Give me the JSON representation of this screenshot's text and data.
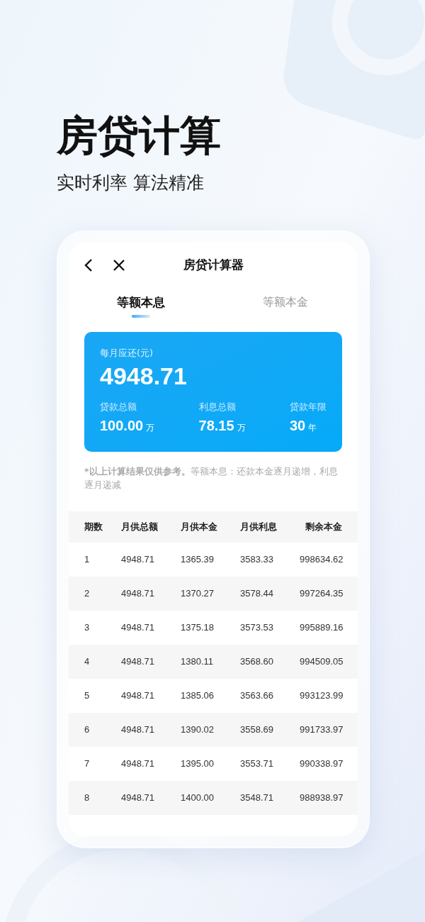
{
  "headline": "房贷计算",
  "subtitle": "实时利率 算法精准",
  "screen": {
    "title": "房贷计算器",
    "tabs": [
      {
        "label": "等额本息",
        "selected": true
      },
      {
        "label": "等额本金",
        "selected": false
      }
    ],
    "summary": {
      "monthly_label": "每月应还(元)",
      "monthly_value": "4948.71",
      "stats": [
        {
          "label": "贷款总额",
          "value": "100.00",
          "unit": "万"
        },
        {
          "label": "利息总额",
          "value": "78.15",
          "unit": "万"
        },
        {
          "label": "贷款年限",
          "value": "30",
          "unit": "年"
        }
      ]
    },
    "note": "***以上计算结果仅供参考。**等额本息：还款本金逐月递增，利息逐月递减",
    "table": {
      "columns": [
        "期数",
        "月供总额",
        "月供本金",
        "月供利息",
        "剩余本金"
      ],
      "rows": [
        [
          "1",
          "4948.71",
          "1365.39",
          "3583.33",
          "998634.62"
        ],
        [
          "2",
          "4948.71",
          "1370.27",
          "3578.44",
          "997264.35"
        ],
        [
          "3",
          "4948.71",
          "1375.18",
          "3573.53",
          "995889.16"
        ],
        [
          "4",
          "4948.71",
          "1380.11",
          "3568.60",
          "994509.05"
        ],
        [
          "5",
          "4948.71",
          "1385.06",
          "3563.66",
          "993123.99"
        ],
        [
          "6",
          "4948.71",
          "1390.02",
          "3558.69",
          "991733.97"
        ],
        [
          "7",
          "4948.71",
          "1395.00",
          "3553.71",
          "990338.97"
        ],
        [
          "8",
          "4948.71",
          "1400.00",
          "3548.71",
          "988938.97"
        ]
      ]
    }
  }
}
